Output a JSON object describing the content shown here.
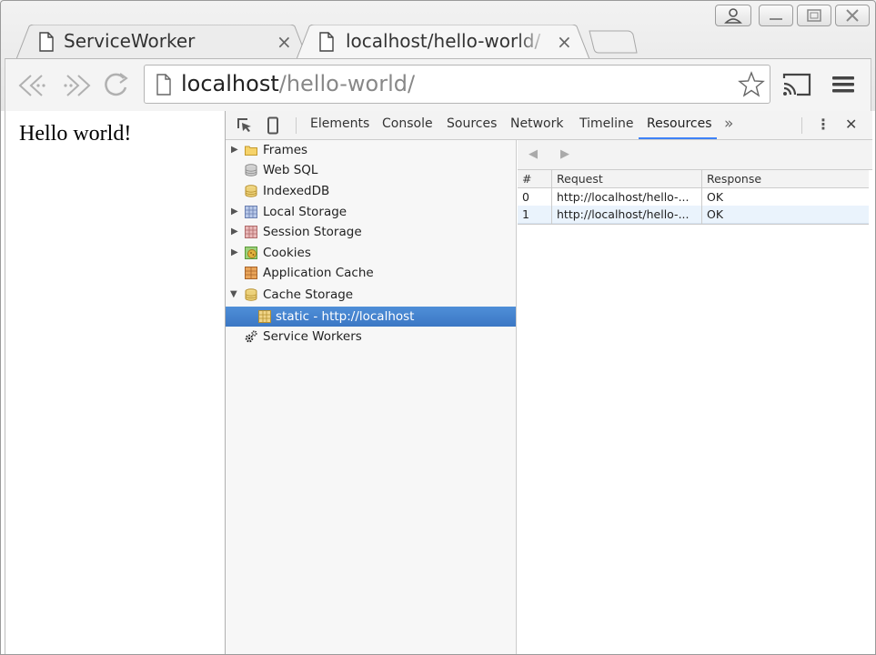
{
  "window": {
    "tabs": [
      {
        "title": "ServiceWorker",
        "close": "×"
      },
      {
        "title": "localhost/hello-world/",
        "close": "×"
      }
    ]
  },
  "toolbar": {
    "url_host": "localhost",
    "url_path": "/hello-world/"
  },
  "page": {
    "content": "Hello world!"
  },
  "devtools": {
    "tabs": [
      "Elements",
      "Console",
      "Sources",
      "Network",
      "Timeline",
      "Resources"
    ],
    "active_tab": "Resources",
    "more": "»",
    "menu": "⋮",
    "close": "✕",
    "tree": [
      {
        "label": "Frames",
        "expander": "▶"
      },
      {
        "label": "Web SQL",
        "expander": ""
      },
      {
        "label": "IndexedDB",
        "expander": ""
      },
      {
        "label": "Local Storage",
        "expander": "▶"
      },
      {
        "label": "Session Storage",
        "expander": "▶"
      },
      {
        "label": "Cookies",
        "expander": "▶"
      },
      {
        "label": "Application Cache",
        "expander": ""
      },
      {
        "label": "Cache Storage",
        "expander": "▼"
      },
      {
        "label": "static - http://localhost",
        "expander": ""
      },
      {
        "label": "Service Workers",
        "expander": ""
      }
    ],
    "cache_table": {
      "nav_prev": "◀",
      "nav_next": "▶",
      "columns": [
        "#",
        "Request",
        "Response"
      ],
      "rows": [
        {
          "index": "0",
          "request": "http://localhost/hello-...",
          "response": "OK"
        },
        {
          "index": "1",
          "request": "http://localhost/hello-...",
          "response": "OK"
        }
      ]
    }
  },
  "colors": {
    "selection": "#3b77c4",
    "active_tab_underline": "#3e82f7",
    "row_alt": "#eaf3fc"
  }
}
